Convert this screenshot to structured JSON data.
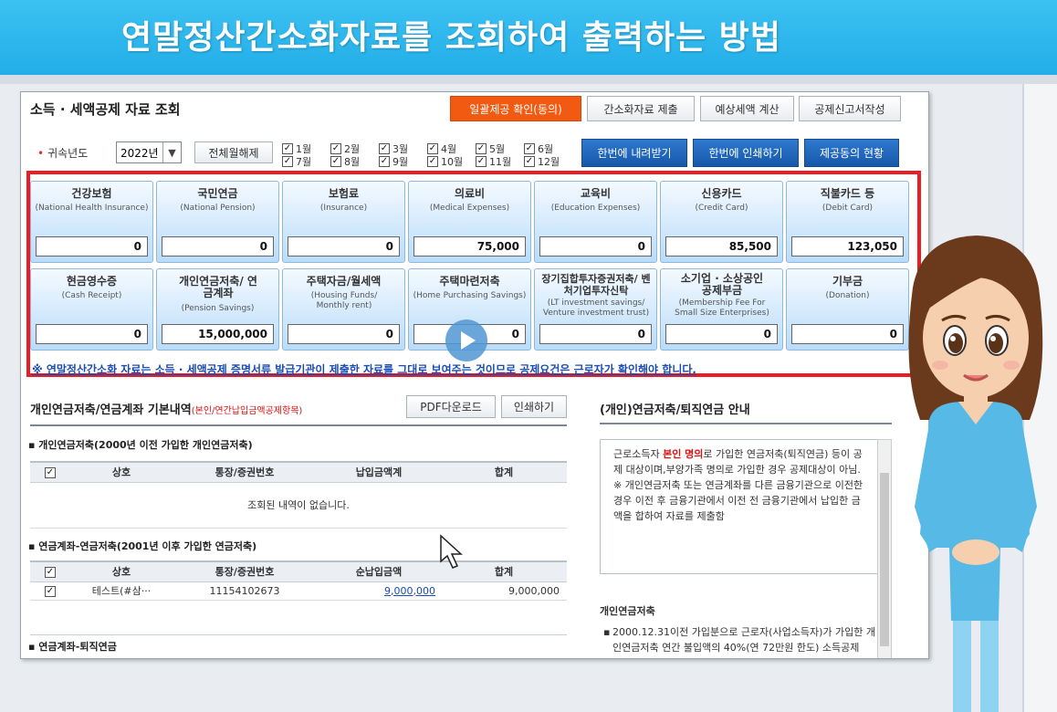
{
  "banner": {
    "title": "연말정산간소화자료를 조회하여 출력하는 방법"
  },
  "header": {
    "title": "소득 · 세액공제 자료 조회",
    "buttons": [
      "일괄제공 확인(동의)",
      "간소화자료 제출",
      "예상세액 계산",
      "공제신고서작성"
    ]
  },
  "filter": {
    "year_label": "귀속년도",
    "year_value": "2022년",
    "release_all": "전체월해제",
    "months": [
      "1월",
      "2월",
      "3월",
      "4월",
      "5월",
      "6월",
      "7월",
      "8월",
      "9월",
      "10월",
      "11월",
      "12월"
    ],
    "actions": [
      "한번에 내려받기",
      "한번에 인쇄하기",
      "제공동의 현황"
    ]
  },
  "categories": [
    {
      "ko": "건강보험",
      "en": "(National Health Insurance)",
      "value": "0"
    },
    {
      "ko": "국민연금",
      "en": "(National Pension)",
      "value": "0"
    },
    {
      "ko": "보험료",
      "en": "(Insurance)",
      "value": "0"
    },
    {
      "ko": "의료비",
      "en": "(Medical Expenses)",
      "value": "75,000"
    },
    {
      "ko": "교육비",
      "en": "(Education Expenses)",
      "value": "0"
    },
    {
      "ko": "신용카드",
      "en": "(Credit Card)",
      "value": "85,500"
    },
    {
      "ko": "직불카드 등",
      "en": "(Debit Card)",
      "value": "123,050"
    },
    {
      "ko": "현금영수증",
      "en": "(Cash Receipt)",
      "value": "0"
    },
    {
      "ko": "개인연금저축/ 연금계좌",
      "en": "(Pension Savings)",
      "value": "15,000,000"
    },
    {
      "ko": "주택자금/월세액",
      "en": "(Housing Funds/ Monthly rent)",
      "value": "0"
    },
    {
      "ko": "주택마련저축",
      "en": "(Home Purchasing Savings)",
      "value": "0"
    },
    {
      "ko": "장기집합투자증권저축/ 벤처기업투자신탁",
      "en": "(LT investment savings/ Venture investment trust)",
      "value": "0"
    },
    {
      "ko": "소기업 · 소상공인 공제부금",
      "en": "(Membership Fee For Small Size Enterprises)",
      "value": "0"
    },
    {
      "ko": "기부금",
      "en": "(Donation)",
      "value": "0"
    }
  ],
  "notice": "※ 연말정산간소화 자료는 소득 · 세액공제 증명서류 발급기관이 제출한 자료를 그대로 보여주는 것이므로 공제요건은 근로자가 확인해야 합니다.",
  "pension_section": {
    "title": "개인연금저축/연금계좌 기본내역",
    "subtitle": "(본인/연간납입금액공제항목)",
    "pdf_button": "PDF다운로드",
    "print_button": "인쇄하기",
    "group1": {
      "title": "개인연금저축(2000년 이전 가입한 개인연금저축)",
      "headers": [
        "상호",
        "통장/증권번호",
        "납입금액계",
        "합계"
      ],
      "empty_text": "조회된 내역이 없습니다."
    },
    "group2": {
      "title": "연금계좌-연금저축(2001년 이후 가입한 연금저축)",
      "headers": [
        "상호",
        "통장/증권번호",
        "순납입금액",
        "합계"
      ],
      "rows": [
        {
          "name": "테스트(#삼···",
          "account": "11154102673",
          "net": "9,000,000",
          "total": "9,000,000"
        }
      ]
    },
    "group3": {
      "title": "연금계좌-퇴직연금"
    }
  },
  "guide": {
    "title": "(개인)연금저축/퇴직연금 안내",
    "box_pre": "근로소득자 ",
    "box_hl": "본인 명의",
    "box_post": "로 가입한 연금저축(퇴직연금) 등이 공제 대상이며,부양가족 명의로 가입한 경우 공제대상이 아님.",
    "box_note": "※ 개인연금저축 또는 연금계좌를 다른 금융기관으로 이전한 경우 이전 후 금융기관에서 이전 전 금융기관에서 납입한 금액을 합하여 자료를 제출함",
    "list_title": "개인연금저축",
    "list_item": "2000.12.31이전 가입분으로 근로자(사업소득자)가 가입한 개인연금저축 연간 불입액의 40%(연 72만원 한도) 소득공제"
  }
}
